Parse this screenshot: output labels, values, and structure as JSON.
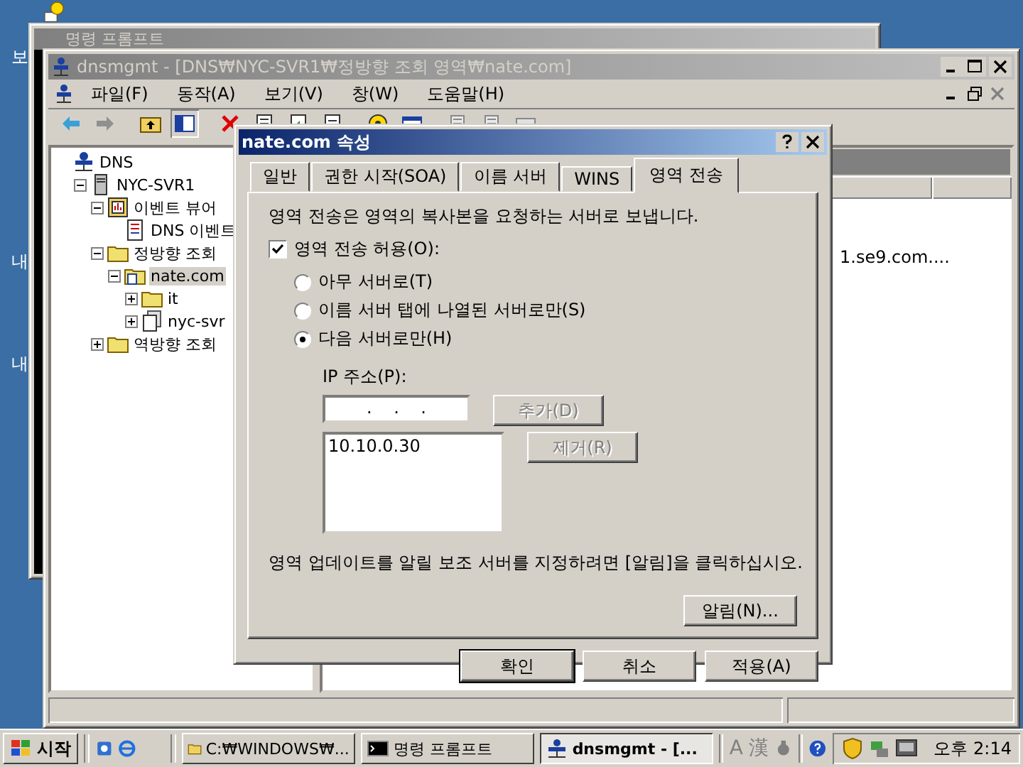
{
  "desktop": {
    "labels": [
      "보",
      "내",
      "내"
    ]
  },
  "cmd_window": {
    "title": "명령 프롬프트"
  },
  "mmc_window": {
    "title": "dnsmgmt - [DNS₩NYC-SVR1₩정방향 조회 영역₩nate.com]",
    "menu": [
      "파일(F)",
      "동작(A)",
      "보기(V)",
      "창(W)",
      "도움말(H)"
    ],
    "toolbar": [
      {
        "kind": "back"
      },
      {
        "kind": "forward"
      },
      {
        "kind": "up"
      },
      {
        "kind": "tree"
      },
      {
        "kind": "delete"
      },
      {
        "kind": "properties"
      },
      {
        "kind": "export"
      },
      {
        "kind": "page"
      },
      {
        "kind": "help"
      },
      {
        "kind": "console"
      },
      {
        "kind": "list"
      },
      {
        "kind": "list"
      },
      {
        "kind": "folder"
      }
    ],
    "tree": [
      {
        "label": "DNS",
        "kind": "dns",
        "selected": false,
        "children": [
          {
            "label": "NYC-SVR1",
            "kind": "server",
            "selected": false,
            "expanded": true,
            "children": [
              {
                "label": "이벤트 뷰어",
                "kind": "event-viewer",
                "selected": false,
                "expanded": true,
                "children": [
                  {
                    "label": "DNS 이벤트",
                    "kind": "event-log",
                    "selected": false
                  }
                ]
              },
              {
                "label": "정방향 조회",
                "kind": "folder",
                "selected": false,
                "expanded": true,
                "children": [
                  {
                    "label": "nate.com",
                    "kind": "zone",
                    "selected": true,
                    "expanded": true,
                    "children": [
                      {
                        "label": "it",
                        "kind": "folder",
                        "selected": false,
                        "expanded": false
                      },
                      {
                        "label": "nyc-svr",
                        "kind": "record",
                        "selected": false,
                        "expanded": false
                      }
                    ]
                  }
                ]
              },
              {
                "label": "역방향 조회",
                "kind": "folder",
                "selected": false,
                "expanded": false
              }
            ]
          }
        ]
      }
    ],
    "detail_text": "1.se9.com...."
  },
  "dialog": {
    "title": "nate.com 속성",
    "tabs": [
      {
        "label": "일반",
        "selected": false
      },
      {
        "label": "권한 시작(SOA)",
        "selected": false
      },
      {
        "label": "이름 서버",
        "selected": false
      },
      {
        "label": "WINS",
        "selected": false
      },
      {
        "label": "영역 전송",
        "selected": true
      }
    ],
    "description": "영역 전송은 영역의 복사본을 요청하는 서버로 보냅니다.",
    "allow_transfer": {
      "label": "영역 전송 허용(O):",
      "checked": true
    },
    "radios": [
      {
        "label": "아무 서버로(T)",
        "selected": false
      },
      {
        "label": "이름 서버 탭에 나열된 서버로만(S)",
        "selected": false
      },
      {
        "label": "다음 서버로만(H)",
        "selected": true
      }
    ],
    "ip_label": "IP 주소(P):",
    "ip_field": {
      "value": ".    .    ."
    },
    "add_button": {
      "label": "추가(D)",
      "disabled": true
    },
    "remove_button": {
      "label": "제거(R)",
      "disabled": true
    },
    "servers": [
      "10.10.0.30"
    ],
    "note": "영역 업데이트를 알릴 보조 서버를 지정하려면 [알림]을 클릭하십시오.",
    "notify_button": "알림(N)...",
    "buttons": [
      {
        "label": "확인",
        "default": true
      },
      {
        "label": "취소",
        "default": false
      },
      {
        "label": "적용(A)",
        "default": false
      }
    ]
  },
  "taskbar": {
    "start": "시작",
    "tasks": [
      {
        "label": "C:₩WINDOWS₩...",
        "kind": "folder",
        "selected": false
      },
      {
        "label": "명령 프롬프트",
        "kind": "cmd",
        "selected": false
      },
      {
        "label": "dnsmgmt - [...",
        "kind": "mmc",
        "selected": true
      }
    ],
    "ime": [
      "A",
      "漢"
    ],
    "clock": "오후 2:14"
  }
}
